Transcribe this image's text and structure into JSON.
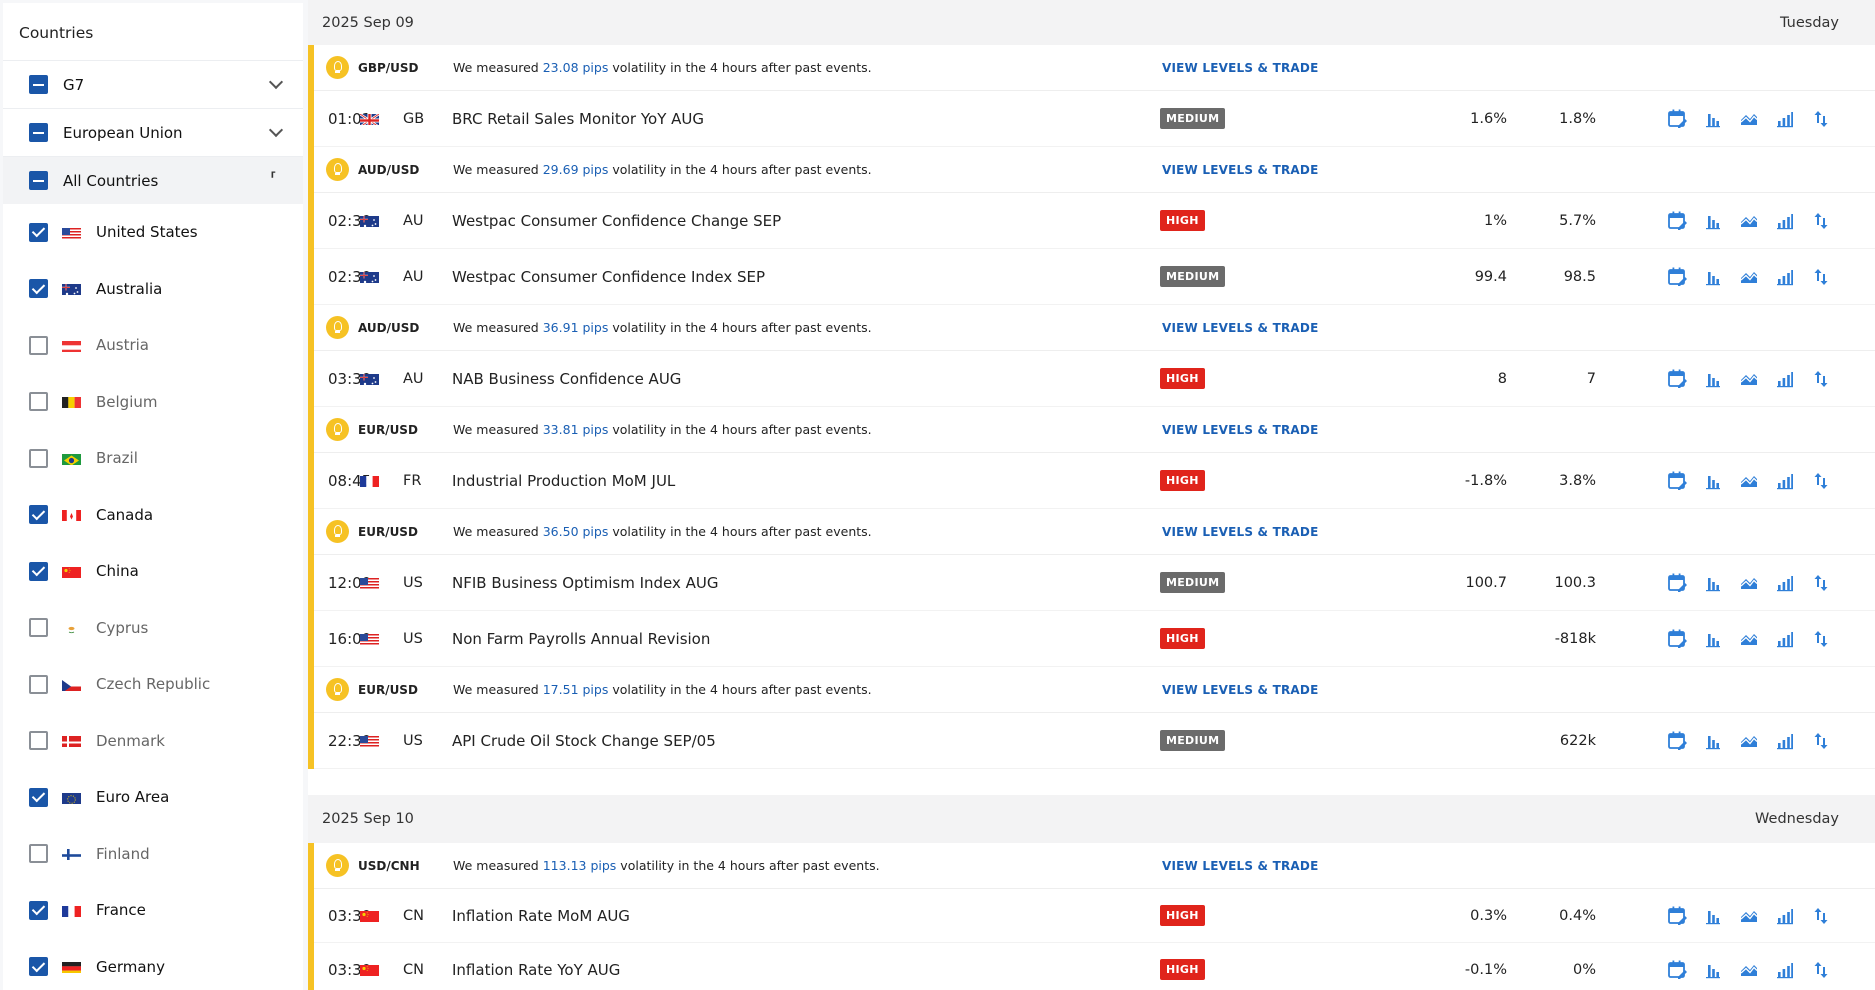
{
  "sidebar": {
    "title": "Countries",
    "groups": [
      {
        "label": "G7"
      },
      {
        "label": "European Union"
      },
      {
        "label": "All Countries"
      }
    ],
    "countries": [
      {
        "label": "United States",
        "checked": true
      },
      {
        "label": "Australia",
        "checked": true
      },
      {
        "label": "Austria",
        "checked": false
      },
      {
        "label": "Belgium",
        "checked": false
      },
      {
        "label": "Brazil",
        "checked": false
      },
      {
        "label": "Canada",
        "checked": true
      },
      {
        "label": "China",
        "checked": true
      },
      {
        "label": "Cyprus",
        "checked": false
      },
      {
        "label": "Czech Republic",
        "checked": false
      },
      {
        "label": "Denmark",
        "checked": false
      },
      {
        "label": "Euro Area",
        "checked": true
      },
      {
        "label": "Finland",
        "checked": false
      },
      {
        "label": "France",
        "checked": true
      },
      {
        "label": "Germany",
        "checked": true
      }
    ]
  },
  "vol_common": {
    "prefix": "We measured",
    "suffix": "volatility in the 4 hours after past events.",
    "link": "VIEW LEVELS & TRADE"
  },
  "days": [
    {
      "date": "2025 Sep 09",
      "weekday": "Tuesday",
      "vol": [
        {
          "pair": "GBP/USD",
          "pips": "23.08 pips"
        },
        {
          "pair": "AUD/USD",
          "pips": "29.69 pips"
        },
        {
          "pair": "AUD/USD",
          "pips": "36.91 pips"
        },
        {
          "pair": "EUR/USD",
          "pips": "33.81 pips"
        },
        {
          "pair": "EUR/USD",
          "pips": "36.50 pips"
        },
        {
          "pair": "EUR/USD",
          "pips": "17.51 pips"
        }
      ],
      "events": [
        {
          "time": "01:01",
          "code": "GB",
          "name": "BRC Retail Sales Monitor YoY AUG",
          "impact": "MEDIUM",
          "v1": "1.6%",
          "v2": "1.8%"
        },
        {
          "time": "02:30",
          "code": "AU",
          "name": "Westpac Consumer Confidence Change SEP",
          "impact": "HIGH",
          "v1": "1%",
          "v2": "5.7%"
        },
        {
          "time": "02:30",
          "code": "AU",
          "name": "Westpac Consumer Confidence Index SEP",
          "impact": "MEDIUM",
          "v1": "99.4",
          "v2": "98.5"
        },
        {
          "time": "03:30",
          "code": "AU",
          "name": "NAB Business Confidence AUG",
          "impact": "HIGH",
          "v1": "8",
          "v2": "7"
        },
        {
          "time": "08:45",
          "code": "FR",
          "name": "Industrial Production MoM JUL",
          "impact": "HIGH",
          "v1": "-1.8%",
          "v2": "3.8%"
        },
        {
          "time": "12:00",
          "code": "US",
          "name": "NFIB Business Optimism Index AUG",
          "impact": "MEDIUM",
          "v1": "100.7",
          "v2": "100.3"
        },
        {
          "time": "16:00",
          "code": "US",
          "name": "Non Farm Payrolls Annual Revision",
          "impact": "HIGH",
          "v1": "",
          "v2": "-818k"
        },
        {
          "time": "22:30",
          "code": "US",
          "name": "API Crude Oil Stock Change SEP/05",
          "impact": "MEDIUM",
          "v1": "",
          "v2": "622k"
        }
      ]
    },
    {
      "date": "2025 Sep 10",
      "weekday": "Wednesday",
      "vol": [
        {
          "pair": "USD/CNH",
          "pips": "113.13 pips"
        }
      ],
      "events": [
        {
          "time": "03:30",
          "code": "CN",
          "name": "Inflation Rate MoM AUG",
          "impact": "HIGH",
          "v1": "0.3%",
          "v2": "0.4%"
        },
        {
          "time": "03:30",
          "code": "CN",
          "name": "Inflation Rate YoY AUG",
          "impact": "HIGH",
          "v1": "-0.1%",
          "v2": "0%"
        }
      ]
    }
  ],
  "colors": {
    "accent_blue": "#1a56a8",
    "high": "#e0241b",
    "medium": "#6b6b6b",
    "bar_yellow": "#f6c224",
    "icon_blue": "#2f7fd8"
  }
}
